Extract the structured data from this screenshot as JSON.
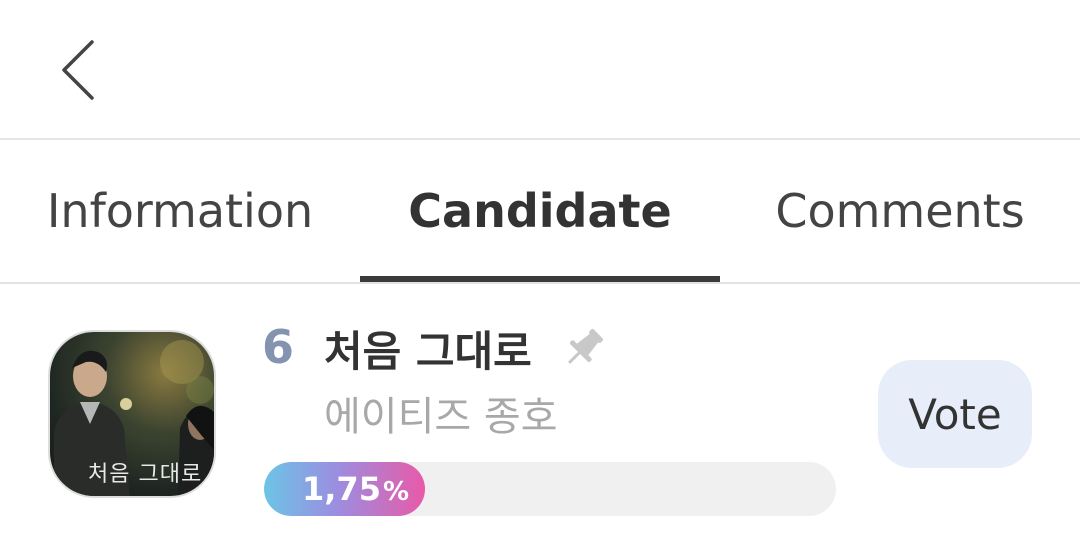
{
  "header": {
    "back_icon": "chevron-left-icon"
  },
  "tabs": [
    {
      "label": "Information",
      "active": false
    },
    {
      "label": "Candidate",
      "active": true
    },
    {
      "label": "Comments",
      "active": false
    }
  ],
  "candidate": {
    "rank": "6",
    "title": "처음 그대로",
    "pin_icon": "pin-icon",
    "artist": "에이티즈 종호",
    "album_cover_text": "처음 그대로",
    "progress_label": "1,75",
    "progress_unit": "%",
    "vote_label": "Vote"
  },
  "colors": {
    "rank": "#8393b0",
    "vote_button_bg": "#e8eef9",
    "progress_gradient_start": "#6cc4e6",
    "progress_gradient_end": "#e85aa8",
    "active_tab_underline": "#3a3a3a"
  }
}
